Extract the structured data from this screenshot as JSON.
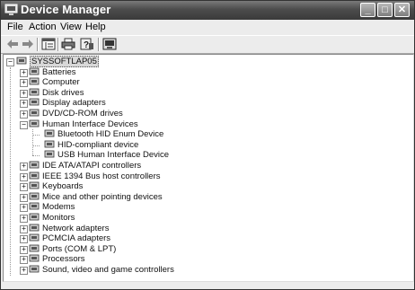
{
  "window": {
    "title": "Device Manager"
  },
  "title_buttons": {
    "minimize": "_",
    "maximize": "□",
    "close": "✕"
  },
  "menu": [
    {
      "label": "File"
    },
    {
      "label": "Action"
    },
    {
      "label": "View"
    },
    {
      "label": "Help"
    }
  ],
  "toolbar": {
    "icons": [
      "back-icon",
      "forward-icon",
      "properties-view-icon",
      "print-icon",
      "help-icon",
      "update-driver-icon"
    ]
  },
  "tree": {
    "root": "SYSSOFTLAP05",
    "expander_collapsed": "+",
    "expander_expanded": "−",
    "items": [
      {
        "label": "Batteries"
      },
      {
        "label": "Computer"
      },
      {
        "label": "Disk drives"
      },
      {
        "label": "Display adapters"
      },
      {
        "label": "DVD/CD-ROM drives"
      },
      {
        "label": "Human Interface Devices",
        "expanded": true,
        "children": [
          {
            "label": "Bluetooth HID Enum Device"
          },
          {
            "label": "HID-compliant device"
          },
          {
            "label": "USB Human Interface Device"
          }
        ]
      },
      {
        "label": "IDE ATA/ATAPI controllers"
      },
      {
        "label": "IEEE 1394 Bus host controllers"
      },
      {
        "label": "Keyboards"
      },
      {
        "label": "Mice and other pointing devices"
      },
      {
        "label": "Modems"
      },
      {
        "label": "Monitors"
      },
      {
        "label": "Network adapters"
      },
      {
        "label": "PCMCIA adapters"
      },
      {
        "label": "Ports (COM & LPT)"
      },
      {
        "label": "Processors"
      },
      {
        "label": "Sound, video and game controllers"
      }
    ]
  }
}
